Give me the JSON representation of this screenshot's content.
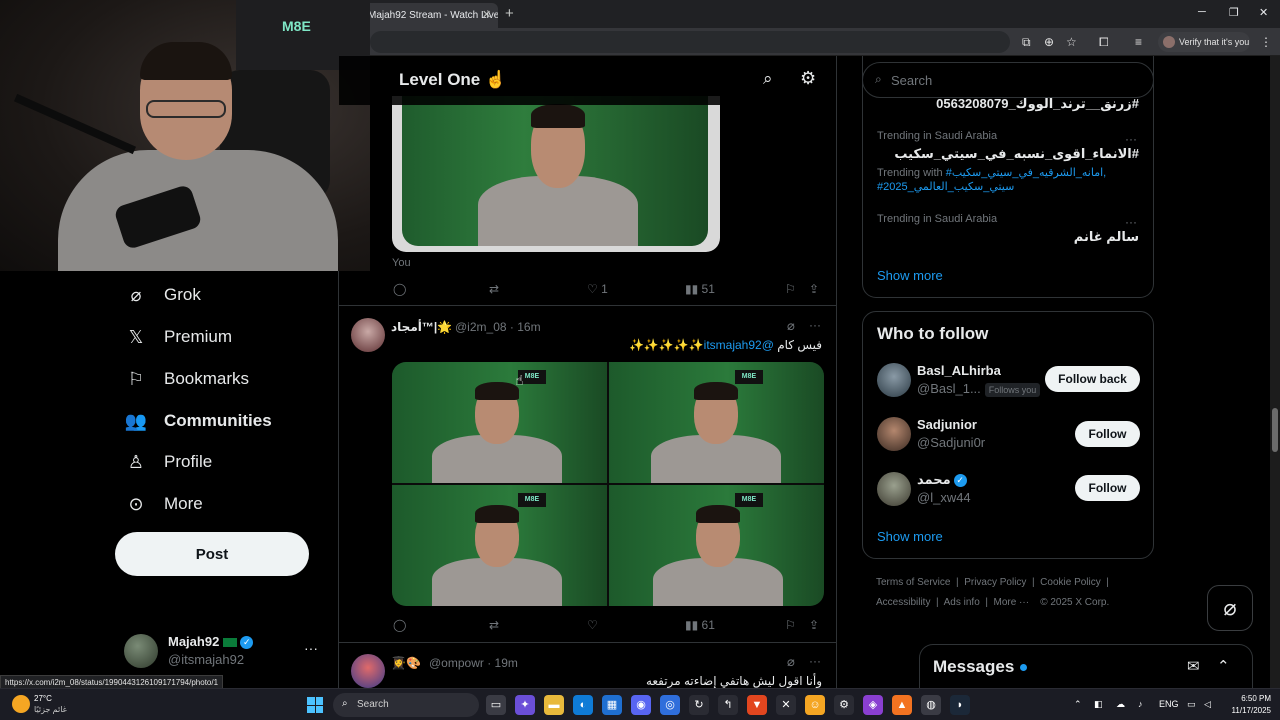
{
  "browser": {
    "tab_title": "Majah92 Stream - Watch Live o",
    "tab_close": "✕",
    "new_tab": "+",
    "verify_label": "Verify that it's you",
    "status_url": "https://x.com/i2m_08/status/1990443126109171794/photo/1"
  },
  "webcam": {
    "logo": "M8E"
  },
  "nav": {
    "items": [
      {
        "label": "Grok",
        "icon": "grok-icon"
      },
      {
        "label": "Premium",
        "icon": "x-logo-icon"
      },
      {
        "label": "Bookmarks",
        "icon": "bookmark-icon"
      },
      {
        "label": "Communities",
        "icon": "communities-icon"
      },
      {
        "label": "Profile",
        "icon": "profile-icon"
      },
      {
        "label": "More",
        "icon": "more-circle-icon"
      }
    ],
    "post_label": "Post",
    "account": {
      "name": "Majah92",
      "handle": "@itsmajah92",
      "more": "···"
    }
  },
  "timeline": {
    "title": "Level One ☝️",
    "tweet1": {
      "you_label": "You",
      "replies": "",
      "retweets": "",
      "likes": "1",
      "views": "51"
    },
    "tweet2": {
      "name": "أمجاد™|🌟",
      "handle": "@i2m_08",
      "time": "16m",
      "text_prefix": "فيس كام ",
      "mention": "@itsmajah92",
      "text_suffix": "✨✨✨✨✨",
      "media_logo": "M8E",
      "views": "61"
    },
    "tweet3": {
      "name": "👩‍🎓🎨",
      "handle": "@ompowr",
      "time": "19m",
      "text": "وأنا اقول ليش هاتفي إضاءته مرتفعه"
    }
  },
  "sidebar": {
    "search_placeholder": "Search",
    "trends": {
      "cut_off_title": "#زرنق__ترند_الووك_0563208079",
      "items": [
        {
          "meta": "Trending in Saudi Arabia",
          "title": "#الانماء_اقوى_نسبه_في_سيتي_سكيب",
          "with_label": "Trending with ",
          "with_tags_1": "#امانه_الشرقيه_في_سيتي_سكيب,",
          "with_tags_2": "#سيتي_سكيب_العالمي_2025"
        },
        {
          "meta": "Trending in Saudi Arabia",
          "title": "سالم غانم"
        }
      ],
      "show_more": "Show more"
    },
    "who_to_follow": {
      "title": "Who to follow",
      "users": [
        {
          "name": "Basl_ALhirba",
          "handle": "@Basl_1...",
          "badge": "Follows you",
          "button": "Follow back"
        },
        {
          "name": "Sadjunior",
          "handle": "@Sadjuni0r",
          "button": "Follow"
        },
        {
          "name": "محمد",
          "handle": "@l_xw44",
          "button": "Follow"
        }
      ],
      "show_more": "Show more"
    },
    "footer": {
      "line1": [
        "Terms of Service",
        "Privacy Policy",
        "Cookie Policy"
      ],
      "line2": [
        "Accessibility",
        "Ads info",
        "More ···",
        "© 2025 X Corp."
      ]
    }
  },
  "messages": {
    "title": "Messages"
  },
  "taskbar": {
    "weather_temp": "27°C",
    "weather_desc": "غائم جزئيًا",
    "weather_badge": "2",
    "search_label": "Search",
    "lang": "ENG",
    "time": "6:50 PM",
    "date": "11/17/2025"
  }
}
